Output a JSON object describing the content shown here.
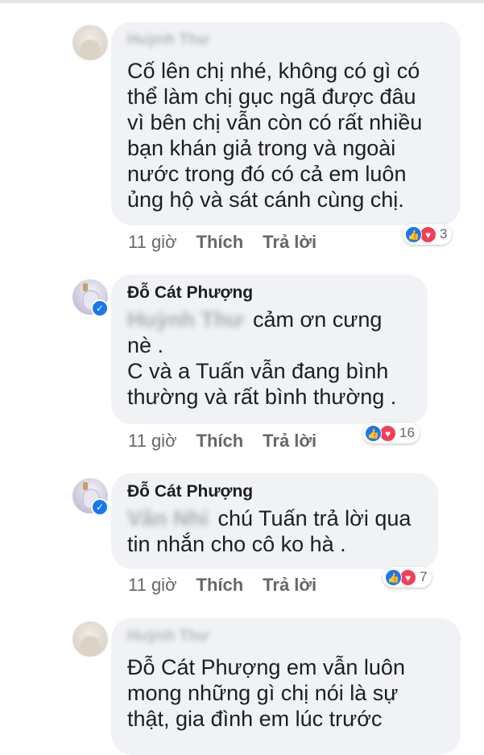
{
  "comments": [
    {
      "author": "Huỳnh Thư",
      "text": "Cố lên chị nhé, không có gì có\nthể làm chị gục ngã được đâu\nvì bên chị vẫn còn có rất nhiều\nbạn khán giả trong và ngoài\nnước trong đó có cả em luôn\nủng hộ và sát cánh cùng chị.",
      "time": "11 giờ",
      "like_label": "Thích",
      "reply_label": "Trả lời",
      "reaction_count": "3"
    },
    {
      "author": "Đỗ Cát Phượng",
      "mention": "Huỳnh Thư",
      "text": "cảm ơn cưng\nnè .\nC và a Tuấn vẫn đang bình\nthường và rất bình thường .",
      "time": "11 giờ",
      "like_label": "Thích",
      "reply_label": "Trả lời",
      "reaction_count": "16"
    },
    {
      "author": "Đỗ Cát Phượng",
      "mention": "Vân Nhi",
      "text": "chú Tuấn trả lời qua\ntin nhắn cho cô ko hà .",
      "time": "11 giờ",
      "like_label": "Thích",
      "reply_label": "Trả lời",
      "reaction_count": "7"
    },
    {
      "author": "Huỳnh Thư",
      "text": "Đỗ Cát Phượng em vẫn luôn\nmong những gì chị nói là sự\nthật, gia đình em lúc trước"
    }
  ],
  "icons": {
    "like": "👍",
    "love": "♥",
    "verified": "✓"
  },
  "colors": {
    "bubble": "#f0f2f5",
    "like_blue": "#1877f2",
    "love_red": "#f33e58",
    "meta_gray": "#65676b"
  }
}
